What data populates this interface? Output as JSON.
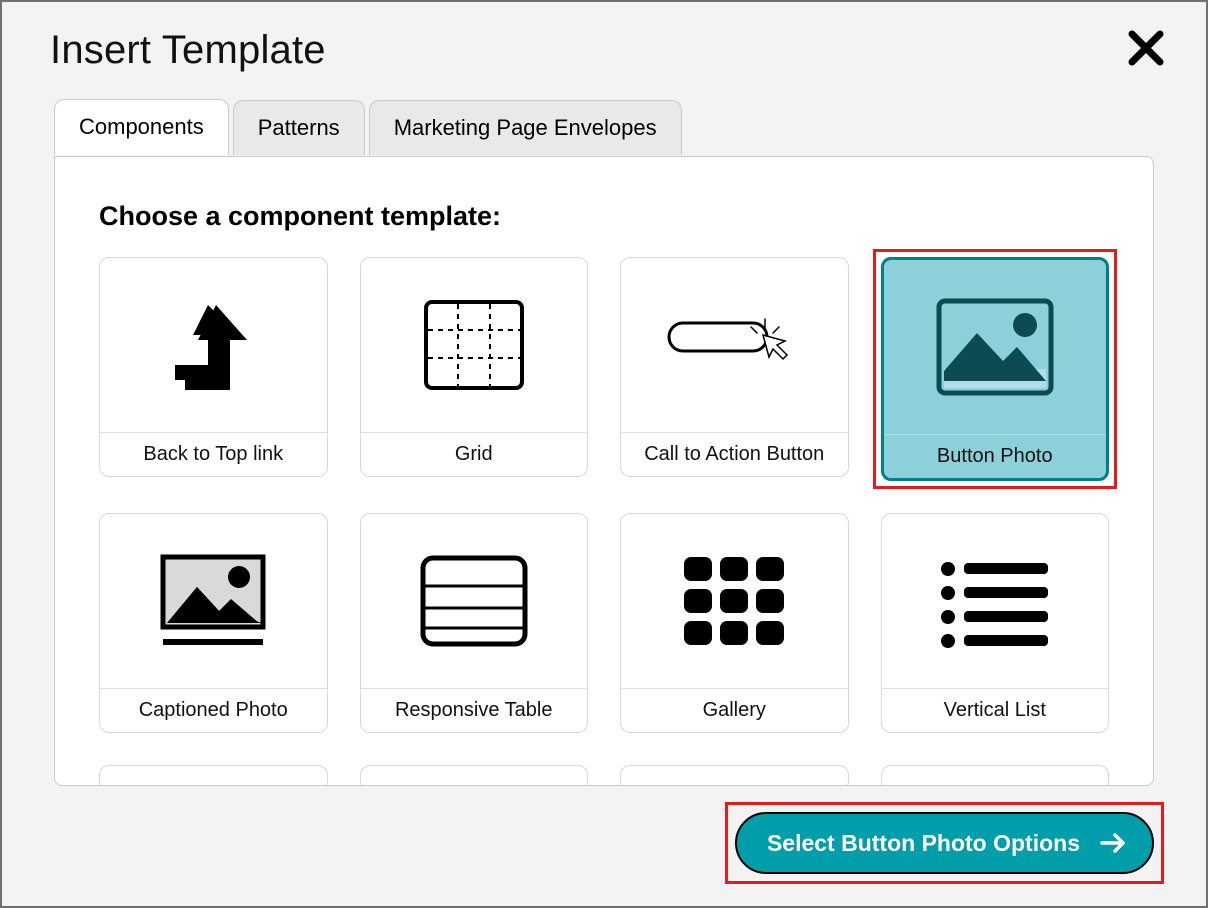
{
  "dialog": {
    "title": "Insert Template"
  },
  "tabs": [
    {
      "label": "Components",
      "active": true
    },
    {
      "label": "Patterns",
      "active": false
    },
    {
      "label": "Marketing Page Envelopes",
      "active": false
    }
  ],
  "panel": {
    "heading": "Choose a component template:"
  },
  "components": [
    {
      "id": "back-to-top",
      "label": "Back to Top link",
      "icon": "arrow-up-turn"
    },
    {
      "id": "grid",
      "label": "Grid",
      "icon": "grid-dashed"
    },
    {
      "id": "cta-button",
      "label": "Call to Action Button",
      "icon": "cursor-button"
    },
    {
      "id": "button-photo",
      "label": "Button Photo",
      "icon": "photo",
      "selected": true,
      "highlighted": true
    },
    {
      "id": "captioned-photo",
      "label": "Captioned Photo",
      "icon": "photo-caption"
    },
    {
      "id": "responsive-table",
      "label": "Responsive Table",
      "icon": "table-rows"
    },
    {
      "id": "gallery",
      "label": "Gallery",
      "icon": "gallery-grid"
    },
    {
      "id": "vertical-list",
      "label": "Vertical List",
      "icon": "bullet-list"
    }
  ],
  "action": {
    "label": "Select Button Photo Options",
    "highlighted": true
  },
  "colors": {
    "accent": "#009DAA",
    "selected_fill": "#8CD1DA",
    "highlight": "#e31d1d"
  }
}
